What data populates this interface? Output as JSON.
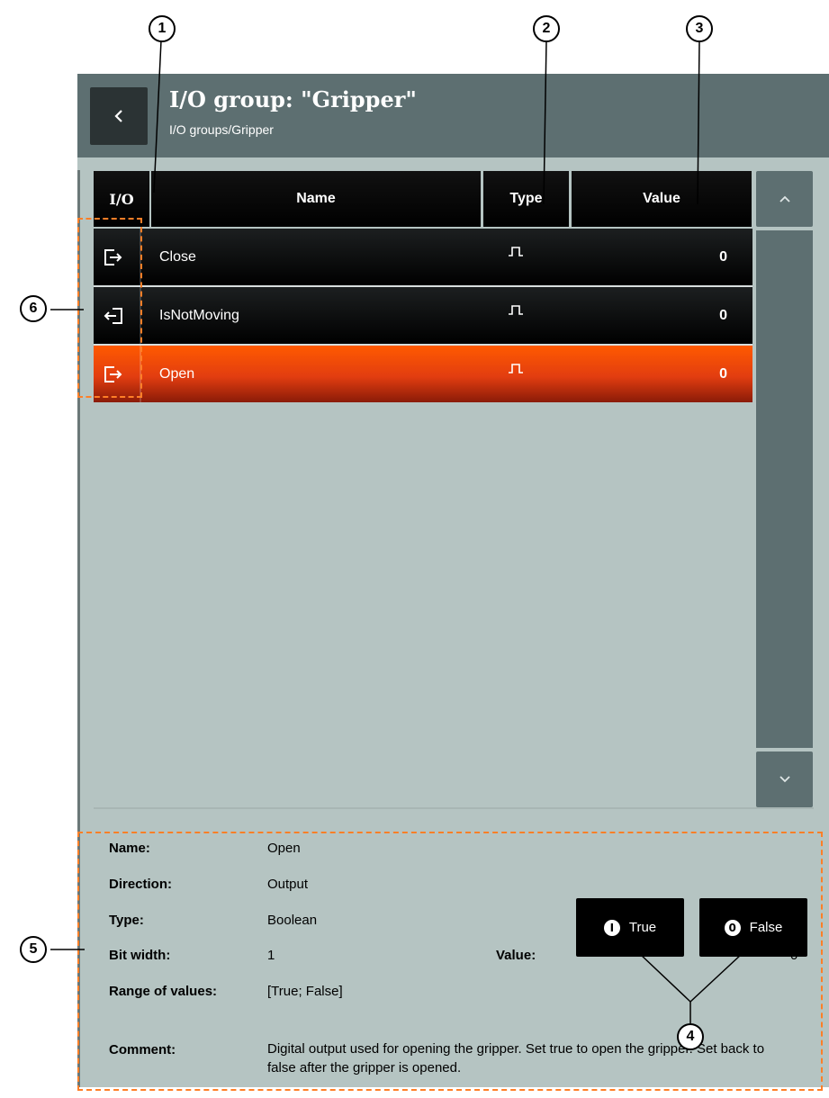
{
  "header": {
    "title": "I/O group: \"Gripper\"",
    "breadcrumb": "I/O groups/Gripper",
    "back_icon": "chevron-left-icon"
  },
  "table": {
    "columns": [
      "I/O",
      "Name",
      "Type",
      "Value"
    ],
    "rows": [
      {
        "io_icon": "output-arrow-icon",
        "name": "Close",
        "type_icon": "pulse-icon",
        "value": "0",
        "selected": false
      },
      {
        "io_icon": "input-arrow-icon",
        "name": "IsNotMoving",
        "type_icon": "pulse-icon",
        "value": "0",
        "selected": false
      },
      {
        "io_icon": "output-arrow-icon",
        "name": "Open",
        "type_icon": "pulse-icon",
        "value": "0",
        "selected": true
      }
    ]
  },
  "scrollbar": {
    "up_icon": "chevron-up-icon",
    "down_icon": "chevron-down-icon"
  },
  "detail": {
    "name_label": "Name:",
    "name_value": "Open",
    "direction_label": "Direction:",
    "direction_value": "Output",
    "type_label": "Type:",
    "type_value": "Boolean",
    "bitwidth_label": "Bit width:",
    "bitwidth_value": "1",
    "range_label": "Range of values:",
    "range_value": "[True; False]",
    "value_label": "Value:",
    "value_value": "0",
    "comment_label": "Comment:",
    "comment_value": "Digital output used for opening the gripper. Set true to open the gripper. Set back to false after the gripper is opened."
  },
  "buttons": {
    "true_icon_glyph": "I",
    "true_label": "True",
    "false_icon_glyph": "0",
    "false_label": "False"
  },
  "callouts": [
    "1",
    "2",
    "3",
    "4",
    "5",
    "6"
  ],
  "colors": {
    "header_bg": "#5d6f71",
    "panel_bg": "#b5c4c2",
    "selected_row": "#ff5a00",
    "highlight_dashes": "#ff7f27"
  }
}
